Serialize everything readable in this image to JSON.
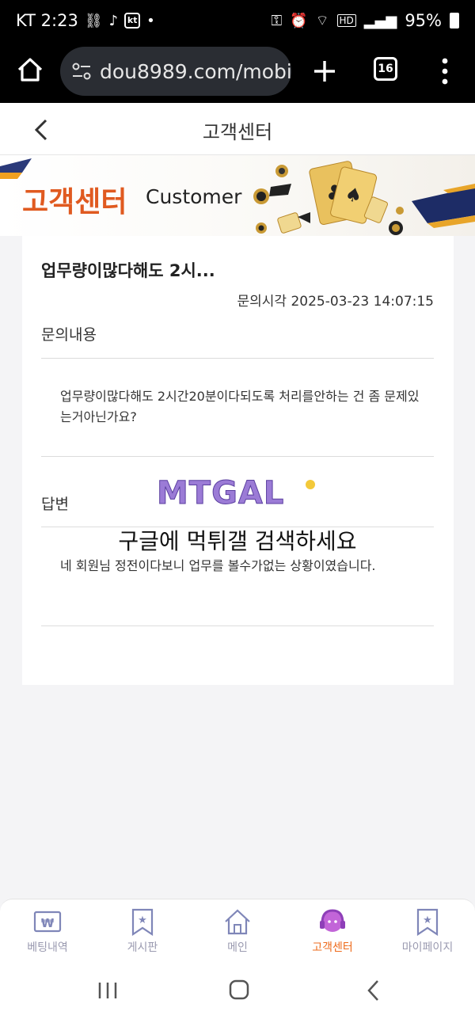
{
  "status_bar": {
    "carrier_time": "KT 2:23",
    "kt_badge": "kt",
    "battery": "95%",
    "hd": "HD"
  },
  "browser": {
    "url": "dou8989.com/mobile",
    "tab_count": "16"
  },
  "header": {
    "title": "고객센터"
  },
  "banner": {
    "title_ko": "고객센터",
    "title_en": "Customer"
  },
  "inquiry": {
    "title": "업무량이많다해도 2시...",
    "time_label": "문의시각 2025-03-23 14:07:15",
    "content_label": "문의내용",
    "content_text": "업무량이많다해도 2시간20분이다되도록 처리를안하는 건 좀 문제있는거아닌가요?",
    "answer_label": "답변",
    "answer_text": "네 회원님 정전이다보니 업무를 볼수가없는 상황이였습니다."
  },
  "watermark": {
    "logo_text": "MTGAL",
    "text": "구글에 먹튀갤 검색하세요"
  },
  "bottom_nav": {
    "items": [
      {
        "label": "베팅내역",
        "icon": "ticket-won-icon"
      },
      {
        "label": "게시판",
        "icon": "bookmark-star-icon"
      },
      {
        "label": "메인",
        "icon": "home-icon"
      },
      {
        "label": "고객센터",
        "icon": "headset-icon",
        "active": true
      },
      {
        "label": "마이페이지",
        "icon": "bookmark-star-icon"
      }
    ],
    "active_color": "#ee6b1c",
    "inactive_color": "#9a9ab0"
  },
  "colors": {
    "accent": "#e05a20",
    "header_bg": "#000000"
  }
}
